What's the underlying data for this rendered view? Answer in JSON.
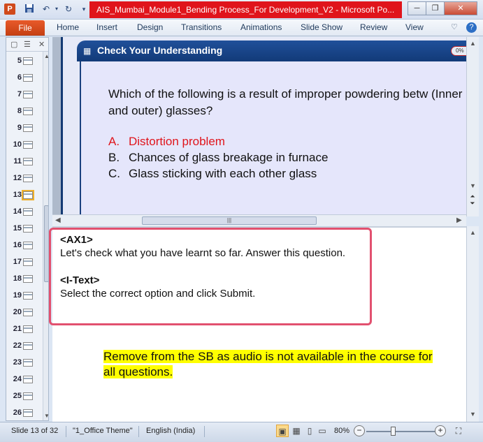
{
  "titlebar": {
    "app_icon": "P",
    "window_title": "AIS_Mumbai_Module1_Bending Process_For Development_V2  -  Microsoft Po...",
    "qat_icons": [
      "save-icon",
      "undo-icon",
      "redo-icon",
      "customize-icon"
    ],
    "minimize": "─",
    "restore": "❐",
    "close": "✕"
  },
  "ribbon": {
    "file_label": "File",
    "tabs": [
      "Home",
      "Insert",
      "Design",
      "Transitions",
      "Animations",
      "Slide Show",
      "Review",
      "View"
    ],
    "help_glyph": "?"
  },
  "thumbnails": {
    "slides": [
      "5",
      "6",
      "7",
      "8",
      "9",
      "10",
      "11",
      "12",
      "13",
      "14",
      "15",
      "16",
      "17",
      "18",
      "19",
      "20",
      "21",
      "22",
      "23",
      "24",
      "25",
      "26"
    ],
    "active_slide": "13"
  },
  "slide": {
    "header_title": "Check Your Understanding",
    "progress_label": "0%",
    "question": "Which of the following is a result of improper powdering betw (Inner and outer) glasses?",
    "options": [
      {
        "letter": "A.",
        "text": "Distortion problem",
        "correct": true
      },
      {
        "letter": "B.",
        "text": "Chances of glass breakage in furnace",
        "correct": false
      },
      {
        "letter": "C.",
        "text": "Glass sticking with each other glass",
        "correct": false
      }
    ],
    "accent_color": "#e0141b",
    "header_color": "#1a4689"
  },
  "notes": {
    "tag1": "<AX1>",
    "text1": "Let's check what you have learnt so far. Answer this question.",
    "tag2": "<I-Text>",
    "text2": "Select the correct option and click Submit.",
    "comment": "Remove from the SB as audio is not available in the course for all questions."
  },
  "statusbar": {
    "slide_info": "Slide 13 of 32",
    "theme": "\"1_Office Theme\"",
    "language": "English (India)",
    "zoom": "80%"
  }
}
